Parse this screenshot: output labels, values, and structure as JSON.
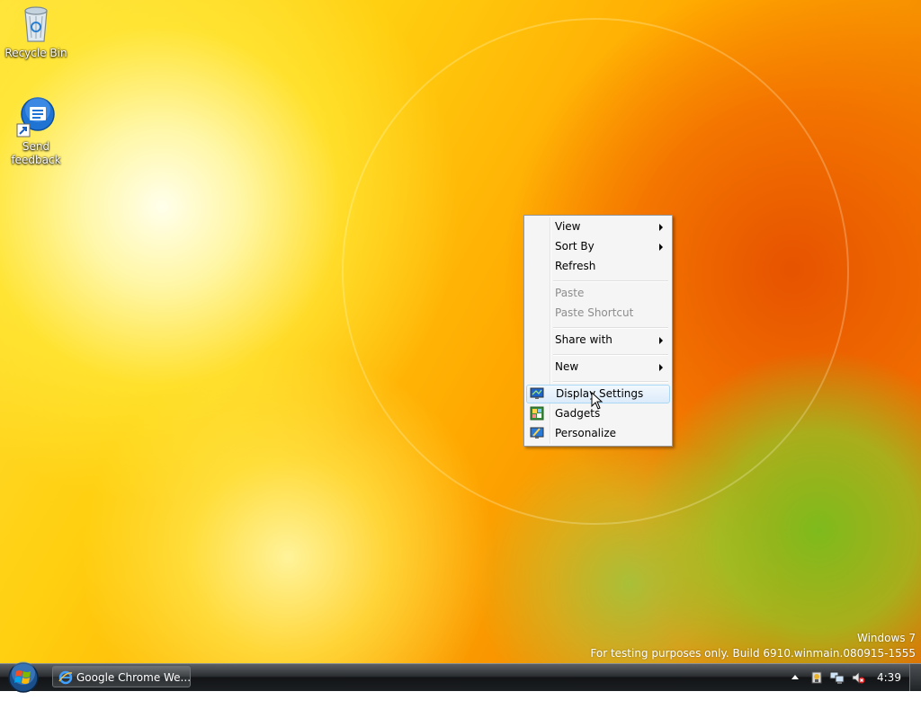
{
  "desktop": {
    "icons": [
      {
        "label": "Recycle Bin"
      },
      {
        "label": "Send feedback"
      }
    ],
    "watermark": {
      "line1": "Windows 7",
      "line2": "For testing purposes only. Build 6910.winmain.080915-1555"
    }
  },
  "context_menu": {
    "items": [
      {
        "label": "View",
        "submenu": true
      },
      {
        "label": "Sort By",
        "submenu": true
      },
      {
        "label": "Refresh"
      },
      {
        "label": "Paste",
        "disabled": true
      },
      {
        "label": "Paste Shortcut",
        "disabled": true
      },
      {
        "label": "Share with",
        "submenu": true
      },
      {
        "label": "New",
        "submenu": true
      },
      {
        "label": "Display Settings",
        "highlighted": true,
        "icon": "display-settings-icon"
      },
      {
        "label": "Gadgets",
        "icon": "gadgets-icon"
      },
      {
        "label": "Personalize",
        "icon": "personalize-icon"
      }
    ]
  },
  "taskbar": {
    "start_icon": "windows-start-icon",
    "tasks": [
      {
        "label": "Google Chrome We...",
        "icon": "internet-explorer-icon"
      }
    ],
    "tray": {
      "icons": [
        "show-hidden-icons-arrow",
        "security-icon",
        "network-icon",
        "volume-muted-icon"
      ],
      "clock": "4:39 AM"
    }
  },
  "colors": {
    "menu_highlight": "#dcebfa",
    "menu_highlight_border": "#a8d8f5",
    "disabled_text": "#8d8d8d"
  }
}
